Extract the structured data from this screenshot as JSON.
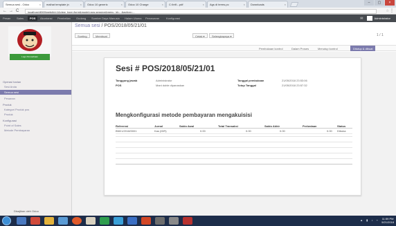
{
  "browser": {
    "tabs": [
      {
        "label": "Semua sesi - Odoo",
        "active": true
      },
      {
        "label": "malhat template jn",
        "active": false
      },
      {
        "label": "Odoo 10 generic",
        "active": false
      },
      {
        "label": "Odoo 10 Charge",
        "active": false
      },
      {
        "label": "C:\\Intl\\...pdf",
        "active": false
      },
      {
        "label": "Ags di terms.pc",
        "active": false
      },
      {
        "label": "Downloads",
        "active": false
      }
    ],
    "url": "localhost:8069/web#id=1&view_type=form&model=pos.session&menu_id=...&action=...",
    "nav_back": "←",
    "nav_forward": "→",
    "nav_reload": "C"
  },
  "topmenu": {
    "items": [
      "Pesan",
      "Sales",
      "POS",
      "Akuntansi",
      "Pembelian",
      "Gudang",
      "Sumber Daya Manusia",
      "Halam Utama",
      "Penawaran",
      "Konfigurasi"
    ],
    "active_index": 2,
    "user": "Administrator"
  },
  "sidebar": {
    "logo_text": "Logo Perusahaan",
    "sections": [
      {
        "heading": "Operasi harian",
        "items": [
          "Sesi Anda",
          "Semua sesi",
          "Pesanan"
        ]
      },
      {
        "heading": "Produk",
        "items": [
          "Kategori Produk pos",
          "Produk"
        ]
      },
      {
        "heading": "Konfigurasi",
        "items": [
          "Point of Sales",
          "Metode Pembayaran"
        ]
      }
    ],
    "active_item": "Semua sesi",
    "footer": "Disajikan oleh Odoo"
  },
  "breadcrumb": {
    "parent": "Semua sesi",
    "sep": " / ",
    "current": "POS/2018/05/21/01"
  },
  "controls": {
    "btn_edit": "Sunting",
    "btn_create": "Membuat",
    "btn_print": "Cetak ▾",
    "btn_more": "Selengkapnya ▾",
    "pager": "1 / 1"
  },
  "statusbar": {
    "stages": [
      "Pembukaan kontrol",
      "Dalam Proses",
      "Menutup kontrol",
      "Ditutup & dibuat"
    ],
    "active_index": 3
  },
  "session": {
    "title": "Sesi # POS/2018/05/21/01",
    "responsible_label": "Tanggung jawab",
    "responsible_value": "Administrator",
    "pos_label": "POS",
    "pos_value": "Mani doble dipanaskan",
    "open_label": "Tanggal pembukaan",
    "open_value": "21/05/2018 23:53:06",
    "close_label": "Tutup Tanggal",
    "close_value": "21/05/2018 23:57:32"
  },
  "payments": {
    "heading": "Mengkonfigurasi metode pembayaran mengakuisisi",
    "columns": [
      "Referensi",
      "Jurnal",
      "Saldo Awal",
      "Total Transaksi",
      "Saldo Akhir",
      "Perbedaan",
      "Status"
    ],
    "rows": [
      [
        "BNK1/2018/0001",
        "Kas (IDR)",
        "0.00",
        "0.00",
        "0.00",
        "0.00",
        "Dibuka"
      ]
    ]
  },
  "taskbar": {
    "clock_time": "11:59 PM",
    "clock_date": "5/21/2018"
  }
}
